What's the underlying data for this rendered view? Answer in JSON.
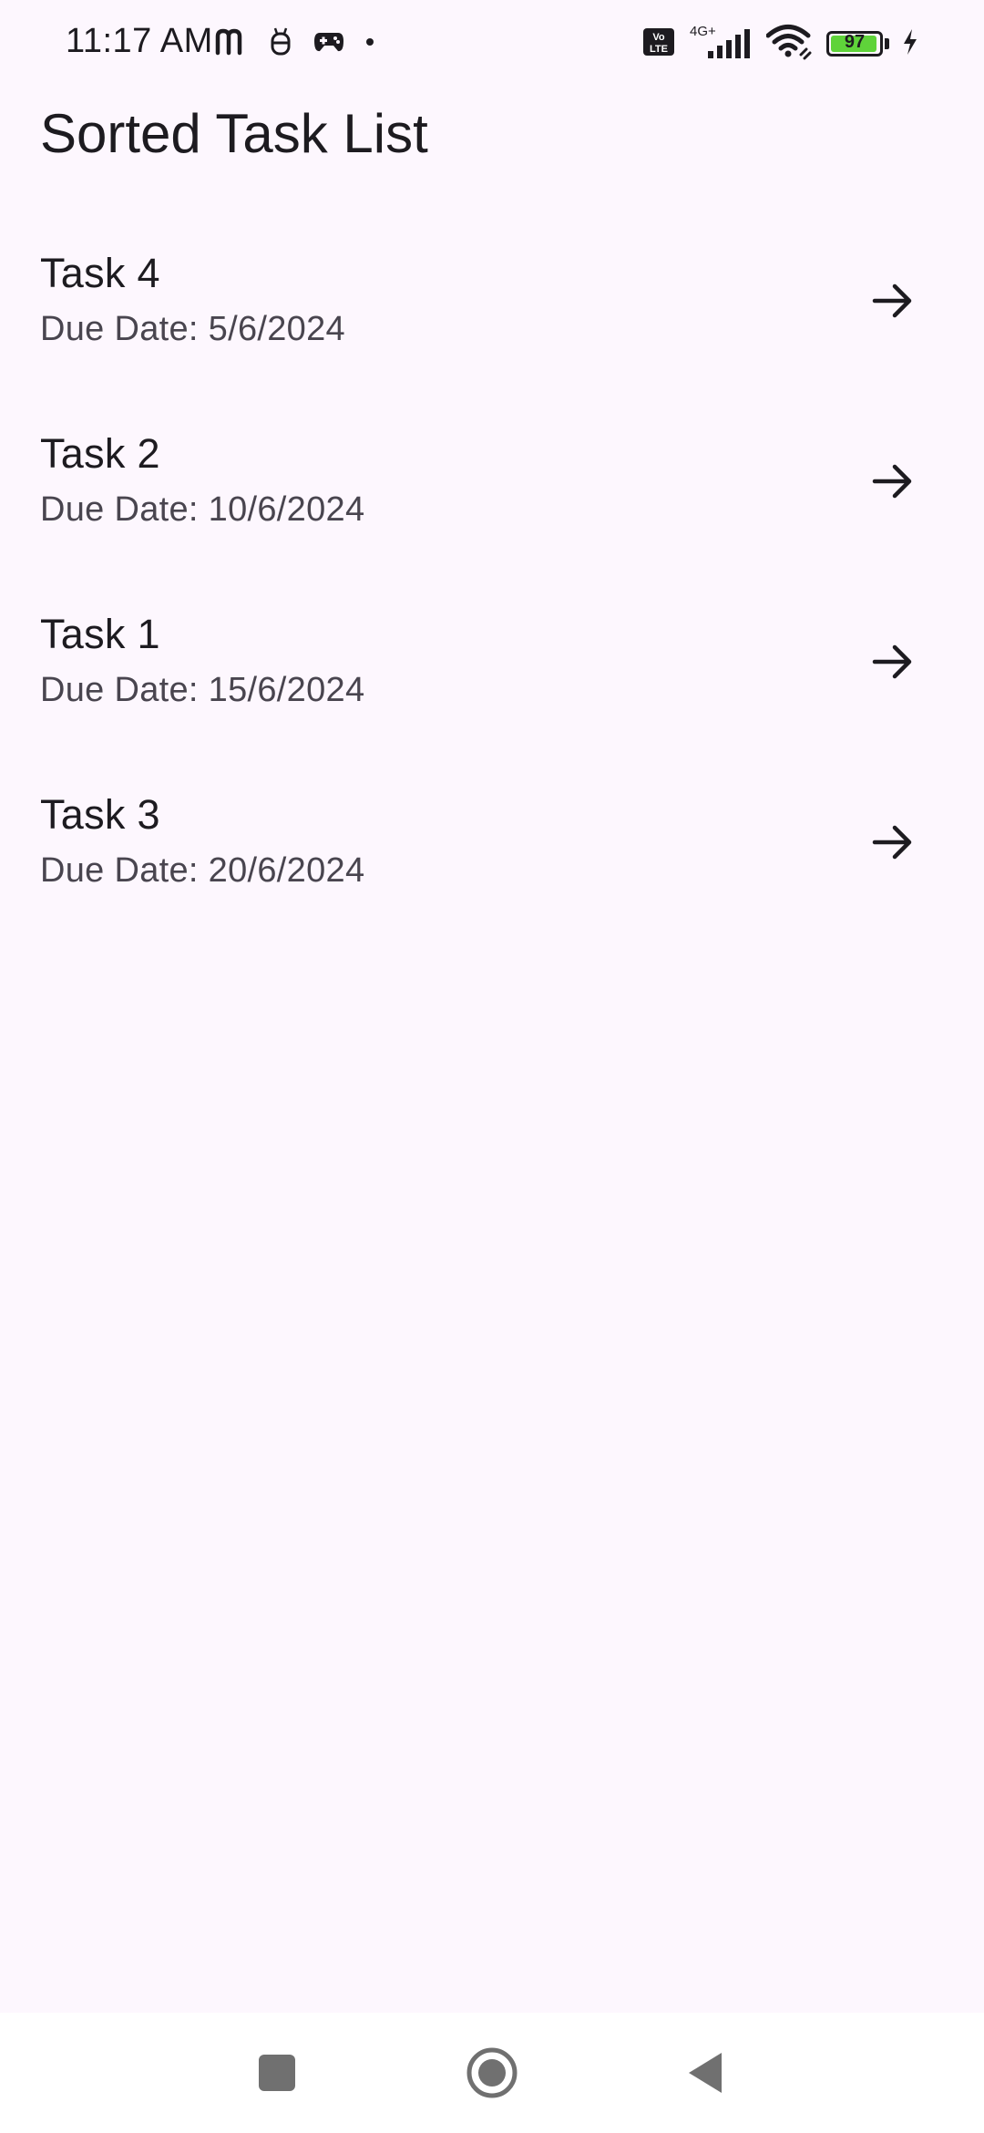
{
  "status_bar": {
    "time": "11:17 AM",
    "network": "4G+",
    "volte": "Vo LTE",
    "battery_level": "97",
    "battery_fraction": 0.97,
    "battery_color": "#5fd33a"
  },
  "app": {
    "title": "Sorted Task List"
  },
  "tasks": [
    {
      "title": "Task 4",
      "due": "Due Date: 5/6/2024",
      "action_icon": "arrow-forward-icon"
    },
    {
      "title": "Task 2",
      "due": "Due Date: 10/6/2024",
      "action_icon": "arrow-forward-icon"
    },
    {
      "title": "Task 1",
      "due": "Due Date: 15/6/2024",
      "action_icon": "arrow-forward-icon"
    },
    {
      "title": "Task 3",
      "due": "Due Date: 20/6/2024",
      "action_icon": "arrow-forward-icon"
    }
  ],
  "nav_bar": {
    "buttons": [
      "recents-icon",
      "home-icon",
      "back-icon"
    ]
  },
  "colors": {
    "background": "#fdf7fe",
    "text_primary": "#1d1b20",
    "text_secondary": "#49454f",
    "nav_background": "#ffffff"
  }
}
